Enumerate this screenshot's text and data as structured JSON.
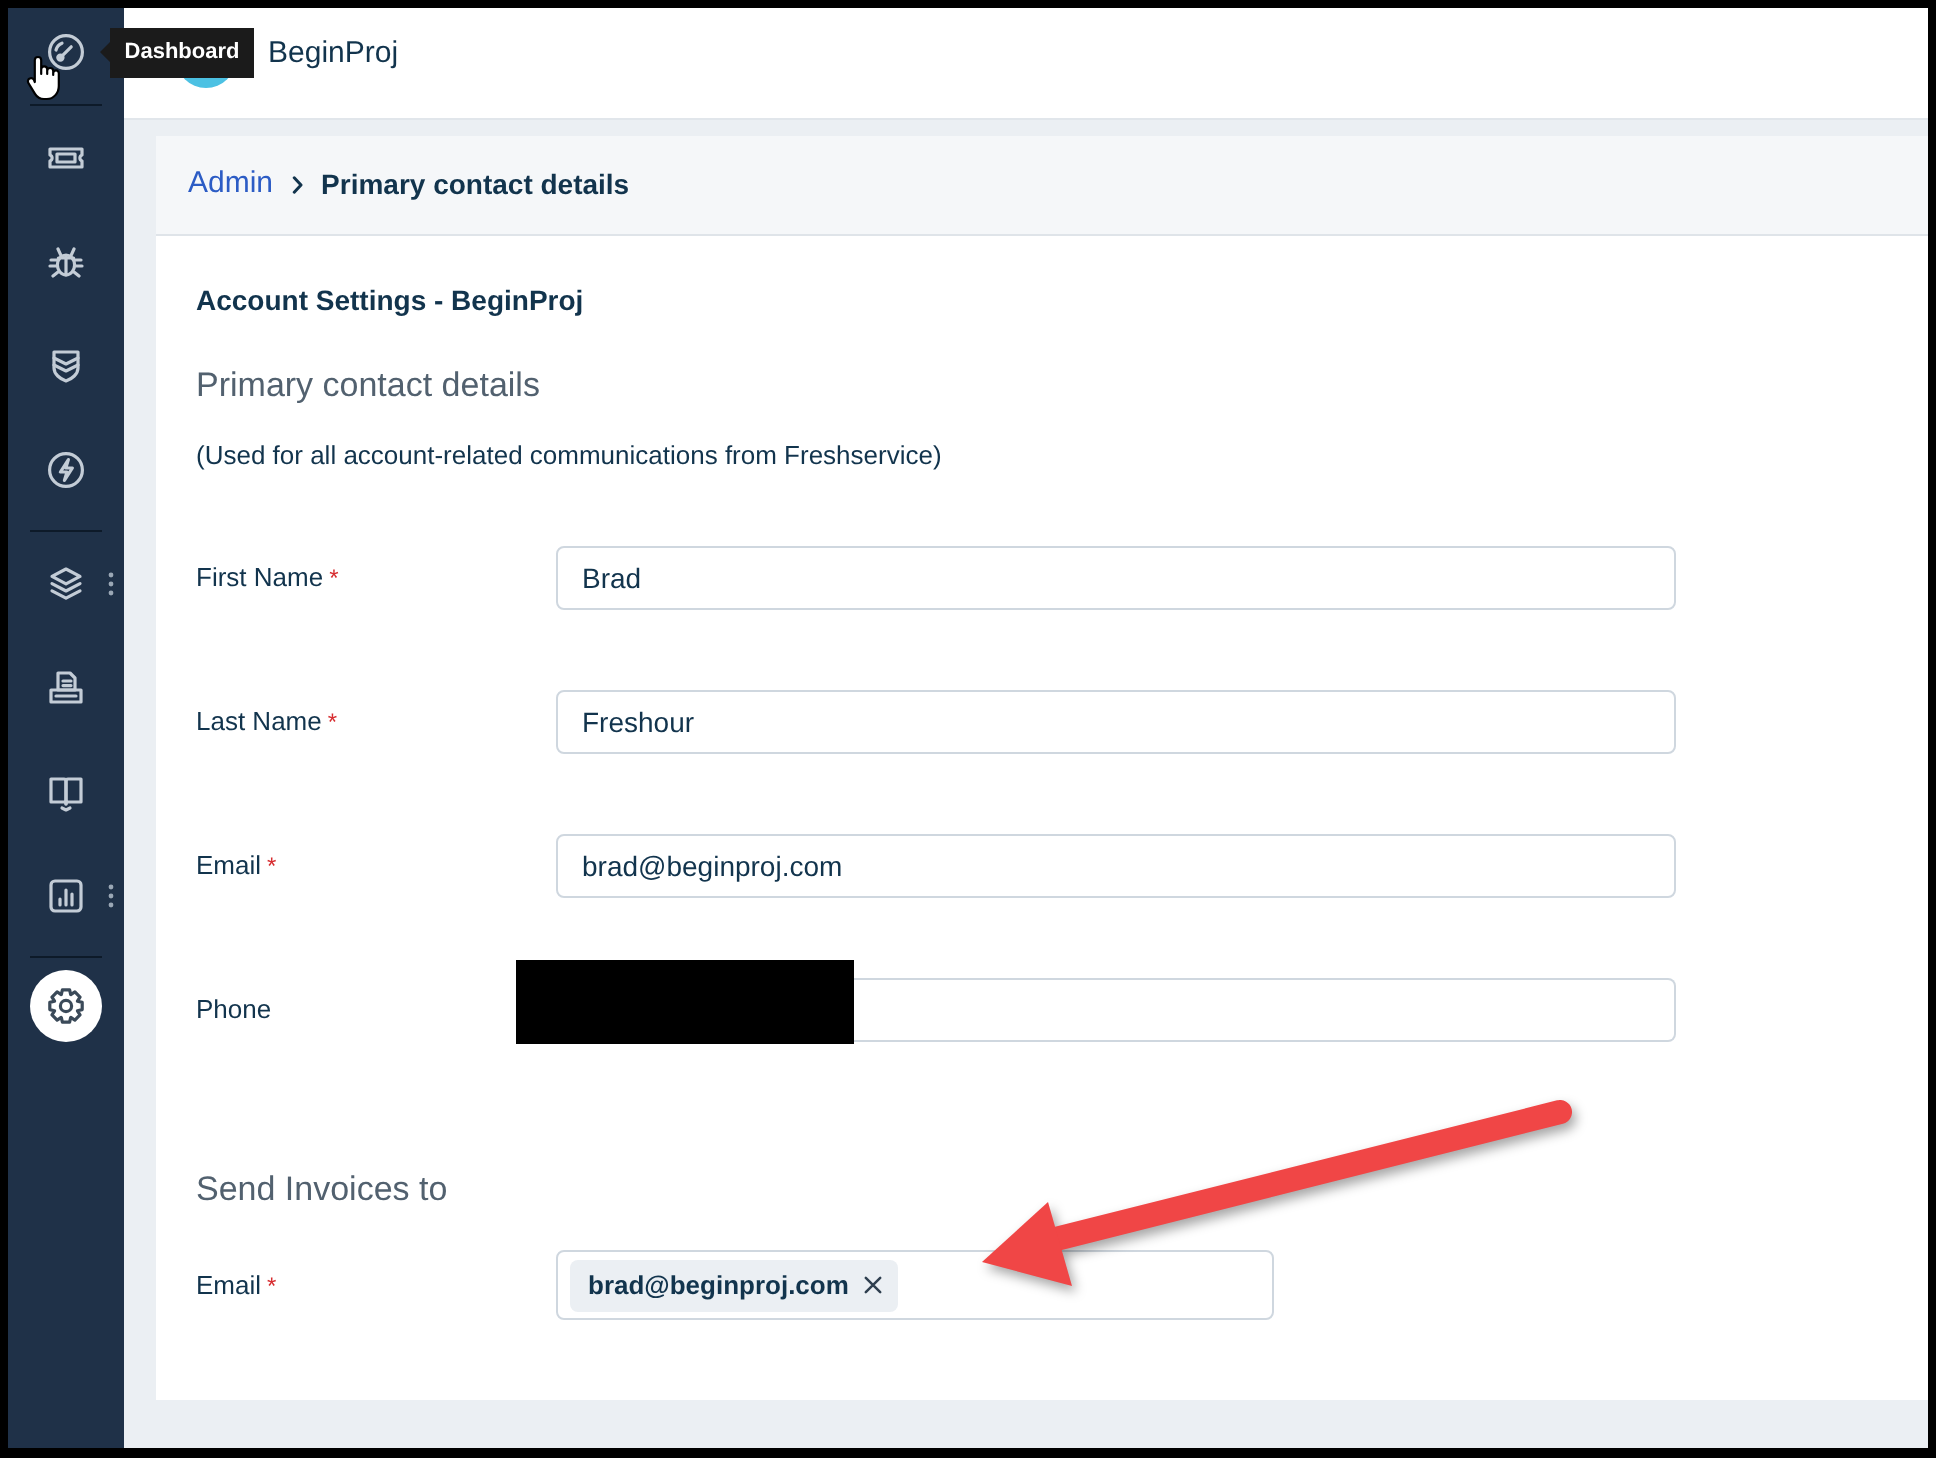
{
  "sidebar": {
    "tooltip": "Dashboard",
    "groups": [
      {
        "items": [
          {
            "selected": false,
            "more": false
          }
        ]
      },
      {
        "items": [
          {
            "selected": false,
            "more": false
          },
          {
            "selected": false,
            "more": false
          },
          {
            "selected": false,
            "more": false
          },
          {
            "selected": false,
            "more": false
          }
        ]
      },
      {
        "items": [
          {
            "selected": false,
            "more": true
          },
          {
            "selected": false,
            "more": false
          },
          {
            "selected": false,
            "more": false
          },
          {
            "selected": false,
            "more": true
          }
        ]
      },
      {
        "items": [
          {
            "selected": true,
            "more": false
          }
        ]
      }
    ]
  },
  "header": {
    "account_name": "BeginProj"
  },
  "breadcrumb": {
    "items": [
      {
        "label": "Admin",
        "link": true
      },
      {
        "label": "Primary contact details",
        "link": false
      }
    ]
  },
  "page": {
    "heading": "Account Settings - BeginProj",
    "section_title": "Primary contact details",
    "note": "(Used for all account-related communications from Freshservice)",
    "fields": [
      {
        "label": "First Name",
        "required_mark": "*",
        "value": "Brad",
        "redacted": false
      },
      {
        "label": "Last Name",
        "required_mark": "*",
        "value": "Freshour",
        "redacted": false
      },
      {
        "label": "Email",
        "required_mark": "*",
        "value": "brad@beginproj.com",
        "redacted": false
      },
      {
        "label": "Phone",
        "redacted": true
      }
    ]
  },
  "invoices": {
    "title": "Send Invoices to",
    "label": "Email",
    "required_mark": "*",
    "tags": [
      {
        "text": "brad@beginproj.com"
      }
    ]
  }
}
